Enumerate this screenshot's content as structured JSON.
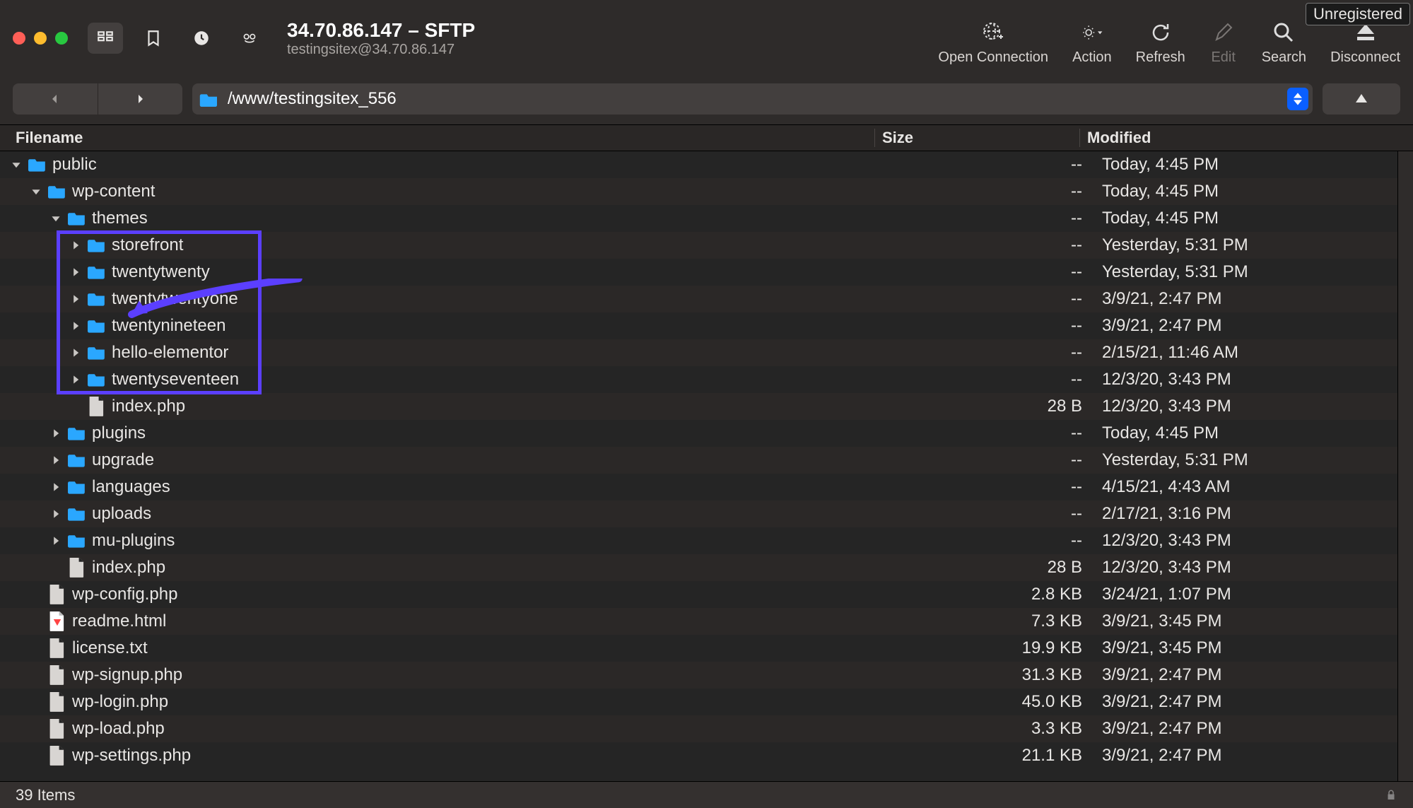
{
  "window": {
    "unregistered_label": "Unregistered",
    "title": "34.70.86.147 – SFTP",
    "subtitle": "testingsitex@34.70.86.147"
  },
  "toolbar": {
    "actions": [
      {
        "id": "open-connection",
        "label": "Open Connection",
        "icon": "globe-plus",
        "disabled": false
      },
      {
        "id": "action",
        "label": "Action",
        "icon": "gear-dropdown",
        "disabled": false
      },
      {
        "id": "refresh",
        "label": "Refresh",
        "icon": "refresh",
        "disabled": false
      },
      {
        "id": "edit",
        "label": "Edit",
        "icon": "pencil",
        "disabled": true
      },
      {
        "id": "search",
        "label": "Search",
        "icon": "magnifier",
        "disabled": false
      },
      {
        "id": "disconnect",
        "label": "Disconnect",
        "icon": "eject",
        "disabled": false
      }
    ]
  },
  "path": {
    "text": "/www/testingsitex_556"
  },
  "columns": {
    "name": "Filename",
    "size": "Size",
    "modified": "Modified"
  },
  "rows": [
    {
      "depth": 0,
      "kind": "folder",
      "disc": "down",
      "name": "public",
      "size": "--",
      "modified": "Today, 4:45 PM",
      "arrow": true
    },
    {
      "depth": 1,
      "kind": "folder",
      "disc": "down",
      "name": "wp-content",
      "size": "--",
      "modified": "Today, 4:45 PM"
    },
    {
      "depth": 2,
      "kind": "folder",
      "disc": "down",
      "name": "themes",
      "size": "--",
      "modified": "Today, 4:45 PM"
    },
    {
      "depth": 3,
      "kind": "folder",
      "disc": "right",
      "name": "storefront",
      "size": "--",
      "modified": "Yesterday, 5:31 PM",
      "hl": true
    },
    {
      "depth": 3,
      "kind": "folder",
      "disc": "right",
      "name": "twentytwenty",
      "size": "--",
      "modified": "Yesterday, 5:31 PM",
      "hl": true
    },
    {
      "depth": 3,
      "kind": "folder",
      "disc": "right",
      "name": "twentytwentyone",
      "size": "--",
      "modified": "3/9/21, 2:47 PM",
      "hl": true
    },
    {
      "depth": 3,
      "kind": "folder",
      "disc": "right",
      "name": "twentynineteen",
      "size": "--",
      "modified": "3/9/21, 2:47 PM",
      "hl": true
    },
    {
      "depth": 3,
      "kind": "folder",
      "disc": "right",
      "name": "hello-elementor",
      "size": "--",
      "modified": "2/15/21, 11:46 AM",
      "hl": true
    },
    {
      "depth": 3,
      "kind": "folder",
      "disc": "right",
      "name": "twentyseventeen",
      "size": "--",
      "modified": "12/3/20, 3:43 PM",
      "hl": true
    },
    {
      "depth": 3,
      "kind": "file",
      "disc": "none",
      "name": "index.php",
      "size": "28 B",
      "modified": "12/3/20, 3:43 PM"
    },
    {
      "depth": 2,
      "kind": "folder",
      "disc": "right",
      "name": "plugins",
      "size": "--",
      "modified": "Today, 4:45 PM"
    },
    {
      "depth": 2,
      "kind": "folder",
      "disc": "right",
      "name": "upgrade",
      "size": "--",
      "modified": "Yesterday, 5:31 PM"
    },
    {
      "depth": 2,
      "kind": "folder",
      "disc": "right",
      "name": "languages",
      "size": "--",
      "modified": "4/15/21, 4:43 AM"
    },
    {
      "depth": 2,
      "kind": "folder",
      "disc": "right",
      "name": "uploads",
      "size": "--",
      "modified": "2/17/21, 3:16 PM"
    },
    {
      "depth": 2,
      "kind": "folder",
      "disc": "right",
      "name": "mu-plugins",
      "size": "--",
      "modified": "12/3/20, 3:43 PM"
    },
    {
      "depth": 2,
      "kind": "file",
      "disc": "none",
      "name": "index.php",
      "size": "28 B",
      "modified": "12/3/20, 3:43 PM"
    },
    {
      "depth": 1,
      "kind": "file",
      "disc": "none",
      "name": "wp-config.php",
      "size": "2.8 KB",
      "modified": "3/24/21, 1:07 PM"
    },
    {
      "depth": 1,
      "kind": "html",
      "disc": "none",
      "name": "readme.html",
      "size": "7.3 KB",
      "modified": "3/9/21, 3:45 PM"
    },
    {
      "depth": 1,
      "kind": "file",
      "disc": "none",
      "name": "license.txt",
      "size": "19.9 KB",
      "modified": "3/9/21, 3:45 PM"
    },
    {
      "depth": 1,
      "kind": "file",
      "disc": "none",
      "name": "wp-signup.php",
      "size": "31.3 KB",
      "modified": "3/9/21, 2:47 PM"
    },
    {
      "depth": 1,
      "kind": "file",
      "disc": "none",
      "name": "wp-login.php",
      "size": "45.0 KB",
      "modified": "3/9/21, 2:47 PM"
    },
    {
      "depth": 1,
      "kind": "file",
      "disc": "none",
      "name": "wp-load.php",
      "size": "3.3 KB",
      "modified": "3/9/21, 2:47 PM"
    },
    {
      "depth": 1,
      "kind": "file",
      "disc": "none",
      "name": "wp-settings.php",
      "size": "21.1 KB",
      "modified": "3/9/21, 2:47 PM"
    }
  ],
  "status": {
    "items": "39 Items"
  }
}
